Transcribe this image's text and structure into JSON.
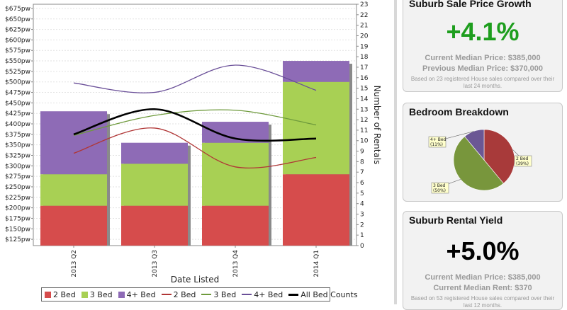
{
  "chart_data": {
    "type": "bar",
    "categories": [
      "2013 Q2",
      "2013 Q3",
      "2013 Q4",
      "2014 Q1"
    ],
    "xlabel": "Date Listed",
    "ylabel_right": "Number of Rentals",
    "y_left_ticks": [
      "$125pw",
      "$150pw",
      "$175pw",
      "$200pw",
      "$225pw",
      "$250pw",
      "$275pw",
      "$300pw",
      "$325pw",
      "$350pw",
      "$375pw",
      "$400pw",
      "$425pw",
      "$450pw",
      "$475pw",
      "$500pw",
      "$525pw",
      "$550pw",
      "$575pw",
      "$600pw",
      "$625pw",
      "$650pw",
      "$675pw"
    ],
    "y_left_range": [
      110,
      685
    ],
    "y_right_range": [
      0,
      23
    ],
    "stacked_series": [
      {
        "name": "2 Bed",
        "color": "#d64c4c",
        "values": [
          205,
          205,
          205,
          280
        ]
      },
      {
        "name": "3 Bed",
        "color": "#a8d054",
        "values": [
          75,
          100,
          150,
          220
        ]
      },
      {
        "name": "4+ Bed",
        "color": "#8e6bb6",
        "values": [
          150,
          50,
          50,
          50
        ]
      }
    ],
    "line_series": [
      {
        "name": "2 Bed",
        "color": "#b03636",
        "width": 1.3,
        "values": [
          8.8,
          11.2,
          7.5,
          8.4
        ]
      },
      {
        "name": "3 Bed",
        "color": "#6e9a3c",
        "width": 1.3,
        "values": [
          10.5,
          12.4,
          12.9,
          11.5
        ]
      },
      {
        "name": "4+ Bed",
        "color": "#6a4f98",
        "width": 1.3,
        "values": [
          15.5,
          14.6,
          17.2,
          14.8
        ]
      },
      {
        "name": "All Bed Counts",
        "color": "#000000",
        "width": 2.6,
        "values": [
          10.6,
          13.0,
          10.2,
          10.2
        ]
      }
    ],
    "legend_position": "bottom"
  },
  "cards": {
    "growth": {
      "title": "Suburb Sale Price Growth",
      "value": "+4.1%",
      "value_color": "#1e9e1e",
      "line1": "Current Median Price: $385,000",
      "line2": "Previous Median Price: $370,000",
      "note": "Based on 23 registered House sales compared over their last 24 months."
    },
    "bedroom": {
      "title": "Bedroom Breakdown",
      "slices": [
        {
          "label": "2 Bed (39%)",
          "line1": "2 Bed",
          "line2": "(39%)",
          "value": 39,
          "color": "#a83a3a"
        },
        {
          "label": "3 Bed (50%)",
          "line1": "3 Bed",
          "line2": "(50%)",
          "value": 50,
          "color": "#78963c"
        },
        {
          "label": "4+ Bed (11%)",
          "line1": "4+ Bed",
          "line2": "(11%)",
          "value": 11,
          "color": "#6b5794"
        }
      ]
    },
    "yield": {
      "title": "Suburb Rental Yield",
      "value": "+5.0%",
      "value_color": "#000000",
      "line1": "Current Median Price: $385,000",
      "line2": "Current Median Rent: $370",
      "note": "Based on 53 registered House sales compared over their last 12 months."
    }
  }
}
